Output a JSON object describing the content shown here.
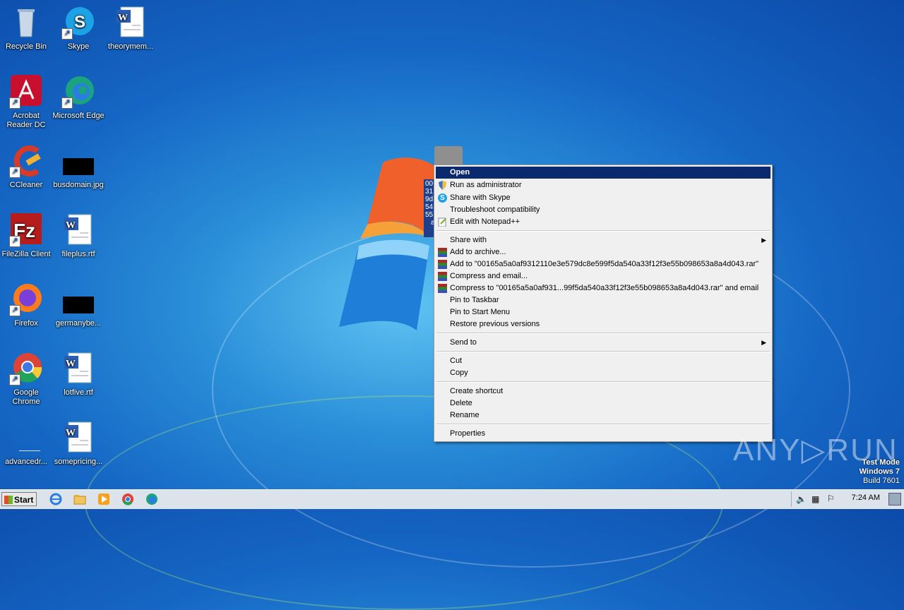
{
  "desktop_icons": [
    {
      "label": "Recycle Bin"
    },
    {
      "label": "Skype"
    },
    {
      "label": "theorymem..."
    },
    {
      "label": "Acrobat Reader DC"
    },
    {
      "label": "Microsoft Edge"
    },
    {
      "label": "CCleaner"
    },
    {
      "label": "busdomain.jpg"
    },
    {
      "label": "FileZilla Client"
    },
    {
      "label": "fileplus.rtf"
    },
    {
      "label": "Firefox"
    },
    {
      "label": "germanybe..."
    },
    {
      "label": "Google Chrome"
    },
    {
      "label": "lotfive.rtf"
    },
    {
      "label": "advancedr..."
    },
    {
      "label": "somepricing..."
    }
  ],
  "selected_file_lines": [
    "00",
    "31",
    "9d",
    "54",
    "55",
    "a"
  ],
  "context_menu": {
    "items": [
      {
        "label": "Open",
        "icon": ""
      },
      {
        "label": "Run as administrator",
        "icon": "shield-icon"
      },
      {
        "label": "Share with Skype",
        "icon": "skype-icon"
      },
      {
        "label": "Troubleshoot compatibility",
        "icon": ""
      },
      {
        "label": "Edit with Notepad++",
        "icon": "notepad-icon"
      },
      {
        "label": "Share with",
        "icon": "",
        "submenu": true
      },
      {
        "label": "Add to archive...",
        "icon": "winrar-icon"
      },
      {
        "label": "Add to \"00165a5a0af9312110e3e579dc8e599f5da540a33f12f3e55b098653a8a4d043.rar\"",
        "icon": "winrar-icon"
      },
      {
        "label": "Compress and email...",
        "icon": "winrar-icon"
      },
      {
        "label": "Compress to \"00165a5a0af931...99f5da540a33f12f3e55b098653a8a4d043.rar\" and email",
        "icon": "winrar-icon"
      },
      {
        "label": "Pin to Taskbar",
        "icon": ""
      },
      {
        "label": "Pin to Start Menu",
        "icon": ""
      },
      {
        "label": "Restore previous versions",
        "icon": ""
      },
      {
        "label": "Send to",
        "icon": "",
        "submenu": true
      },
      {
        "label": "Cut",
        "icon": ""
      },
      {
        "label": "Copy",
        "icon": ""
      },
      {
        "label": "Create shortcut",
        "icon": ""
      },
      {
        "label": "Delete",
        "icon": ""
      },
      {
        "label": "Rename",
        "icon": ""
      },
      {
        "label": "Properties",
        "icon": ""
      }
    ],
    "submenu_arrow": "▶"
  },
  "taskbar": {
    "start_label": "Start",
    "clock": "7:24 AM"
  },
  "watermark": {
    "line1": "Test Mode",
    "line2": "Windows 7",
    "line3": "Build 7601"
  },
  "brand_watermark": "ANY▷RUN"
}
